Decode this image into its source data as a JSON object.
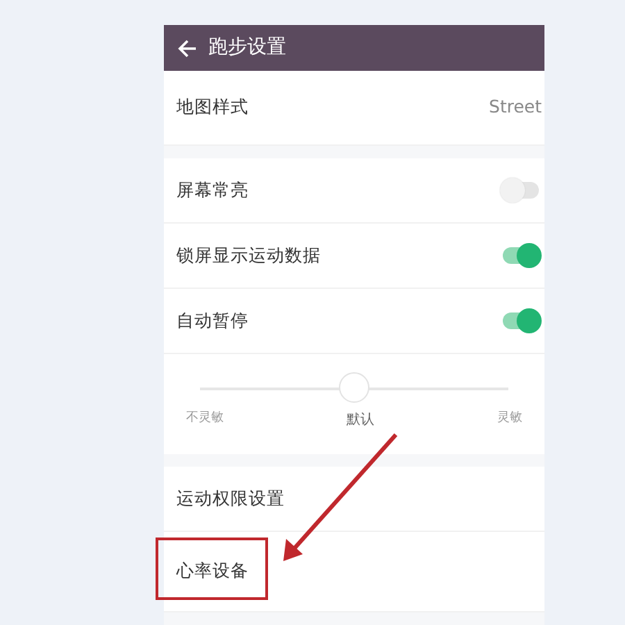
{
  "header": {
    "title": "跑步设置"
  },
  "sections": [
    [
      {
        "kind": "value",
        "label": "地图样式",
        "value": "Street",
        "highlighted": false
      }
    ],
    [
      {
        "kind": "toggle",
        "label": "屏幕常亮",
        "on": false,
        "highlighted": false
      },
      {
        "kind": "toggle",
        "label": "锁屏显示运动数据",
        "on": true,
        "highlighted": false
      },
      {
        "kind": "toggle",
        "label": "自动暂停",
        "on": true,
        "highlighted": false
      },
      {
        "kind": "slider",
        "level": 0.5,
        "labels": [
          "不灵敏",
          "默认",
          "灵敏"
        ],
        "highlighted": false
      }
    ],
    [
      {
        "kind": "link",
        "label": "运动权限设置",
        "highlighted": false
      },
      {
        "kind": "link",
        "label": "心率设备",
        "highlighted": true
      }
    ]
  ]
}
